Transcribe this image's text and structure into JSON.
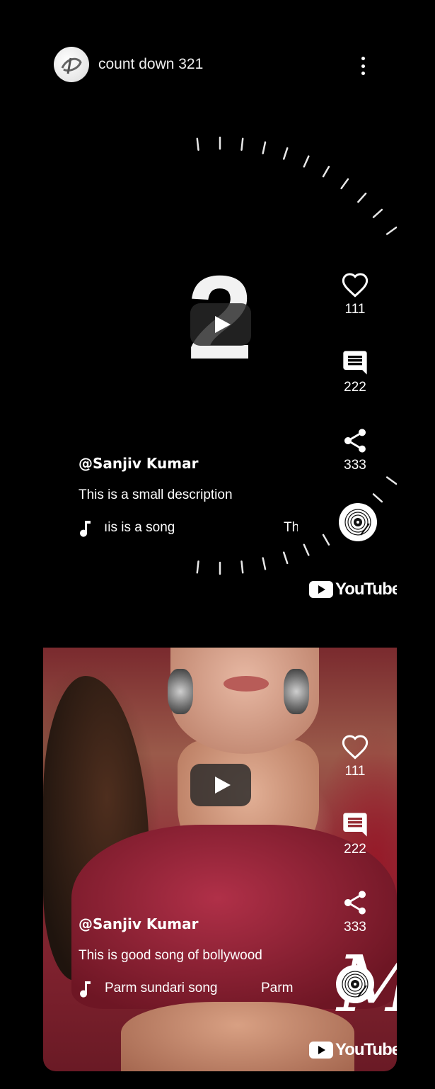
{
  "videos": [
    {
      "channel_title": "count down 321",
      "display_number": "2",
      "likes": "111",
      "comments": "222",
      "shares": "333",
      "author": "@Sanjiv Kumar",
      "description": "This is a small description",
      "song_scroll_a": "ıis is a song",
      "song_scroll_b": "Th",
      "watermark": "YouTube"
    },
    {
      "likes": "111",
      "comments": "222",
      "shares": "333",
      "author": "@Sanjiv Kumar",
      "description": "This is good song of bollywood",
      "song_scroll_a": "Parm sundari song",
      "song_scroll_b": "Parm",
      "watermark": "YouTube"
    }
  ],
  "icons": {
    "like": "heart-outline-icon",
    "comment": "comment-icon",
    "share": "share-icon",
    "music": "music-note-icon",
    "disc": "vinyl-disc-icon",
    "play": "play-icon",
    "more": "more-vertical-icon"
  },
  "colors": {
    "background": "#000000",
    "text": "#ffffff"
  }
}
